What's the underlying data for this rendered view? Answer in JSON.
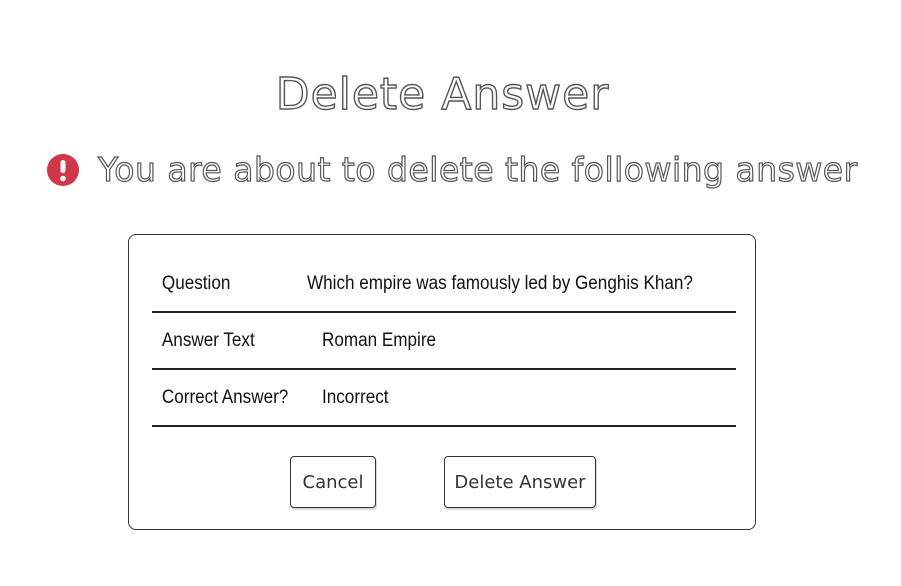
{
  "page": {
    "title": "Delete Answer"
  },
  "warning": {
    "icon": "exclamation-circle-icon",
    "icon_color": "#d0384a",
    "text": "You are about to delete the following answer"
  },
  "details": [
    {
      "label": "Question",
      "value": "Which empire was famously led by Genghis Khan?"
    },
    {
      "label": "Answer Text",
      "value": "Roman Empire"
    },
    {
      "label": "Correct Answer?",
      "value": "Incorrect"
    }
  ],
  "actions": {
    "cancel_label": "Cancel",
    "delete_label": "Delete Answer"
  }
}
